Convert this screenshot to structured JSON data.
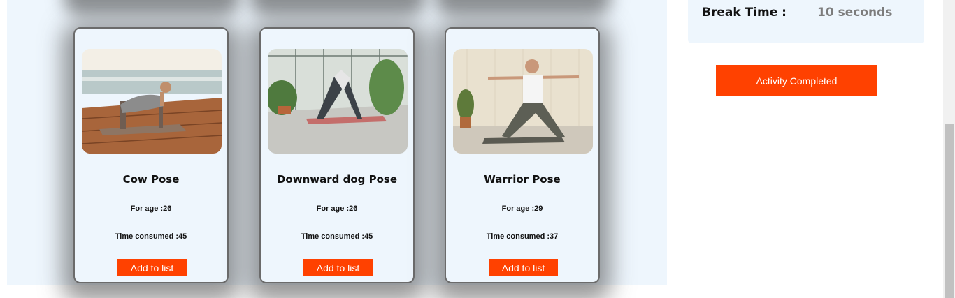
{
  "break": {
    "label": "Break Time :",
    "value": "10 seconds"
  },
  "actions": {
    "complete_label": "Activity Completed"
  },
  "cards": [
    {
      "title": "Cow Pose",
      "age": "For age :26",
      "time": "Time consumed :45",
      "button": "Add to list"
    },
    {
      "title": "Downward dog Pose",
      "age": "For age :26",
      "time": "Time consumed :45",
      "button": "Add to list"
    },
    {
      "title": "Warrior Pose",
      "age": "For age :29",
      "time": "Time consumed :37",
      "button": "Add to list"
    }
  ],
  "colors": {
    "accent": "#ff4100",
    "panel": "#eef6fd",
    "muted": "#7c7c7c"
  }
}
